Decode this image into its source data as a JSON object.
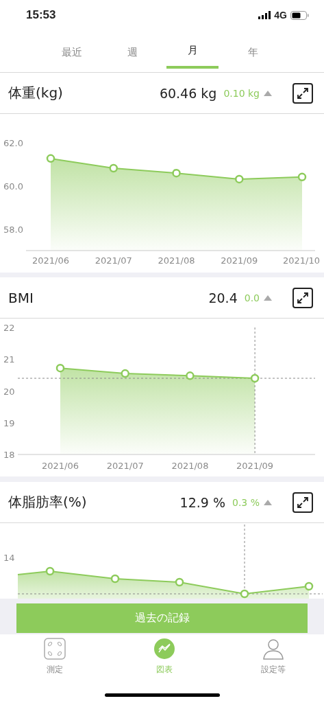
{
  "status_bar": {
    "time": "15:53",
    "network": "4G"
  },
  "tabs": [
    {
      "label": "最近",
      "selected": false
    },
    {
      "label": "週",
      "selected": false
    },
    {
      "label": "月",
      "selected": true
    },
    {
      "label": "年",
      "selected": false
    }
  ],
  "panels": [
    {
      "title": "体重(kg)",
      "value": "60.46 kg",
      "change": "0.10 kg",
      "chart_data": {
        "type": "area",
        "categories": [
          "2021/06",
          "2021/07",
          "2021/08",
          "2021/09",
          "2021/10"
        ],
        "series": [
          {
            "color": "#8dcb5b",
            "values": [
              61.28,
              60.83,
              60.6,
              60.32,
              60.42
            ]
          }
        ],
        "ylim": [
          57,
          62
        ],
        "yticks": [
          {
            "value": 58,
            "label": "58.0"
          },
          {
            "value": 60,
            "label": "60.0"
          },
          {
            "value": 62,
            "label": "62.0"
          }
        ]
      }
    },
    {
      "title": "BMI",
      "value": "20.4",
      "change": "0.0",
      "chart_data": {
        "type": "area",
        "categories": [
          "2021/06",
          "2021/07",
          "2021/08",
          "2021/09"
        ],
        "series": [
          {
            "color": "#8dcb5b",
            "values": [
              20.72,
              20.55,
              20.48,
              20.4
            ]
          }
        ],
        "ylim": [
          18,
          22
        ],
        "yticks": [
          18,
          19,
          20,
          21,
          22
        ]
      },
      "markers": [
        {
          "selected": false
        },
        {
          "selected": false
        },
        {
          "selected": false
        },
        {
          "selected": true
        }
      ]
    },
    {
      "title": "体脂肪率(%)",
      "value": "12.9 %",
      "change": "0.3 %",
      "axis_label": "14"
    }
  ],
  "history_button": {
    "label": "過去の記録"
  },
  "nav": [
    {
      "label": "測定",
      "selected": false
    },
    {
      "label": "図表",
      "selected": true
    },
    {
      "label": "設定等",
      "selected": false
    }
  ]
}
